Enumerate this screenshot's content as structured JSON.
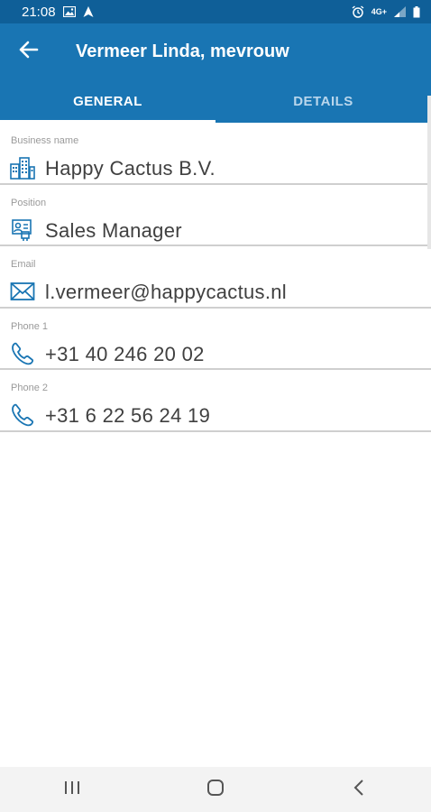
{
  "status_bar": {
    "time": "21:08",
    "network_label": "4G+"
  },
  "header": {
    "title": "Vermeer Linda, mevrouw",
    "back_icon": "arrow-left-icon"
  },
  "tabs": [
    {
      "label": "GENERAL",
      "active": true
    },
    {
      "label": "DETAILS",
      "active": false
    }
  ],
  "fields": [
    {
      "label": "Business name",
      "value": "Happy Cactus B.V.",
      "icon": "buildings-icon"
    },
    {
      "label": "Position",
      "value": "Sales Manager",
      "icon": "id-badge-icon"
    },
    {
      "label": "Email",
      "value": "l.vermeer@happycactus.nl",
      "icon": "envelope-icon"
    },
    {
      "label": "Phone 1",
      "value": "+31 40 246 20 02",
      "icon": "phone-icon"
    },
    {
      "label": "Phone 2",
      "value": "+31 6 22 56 24 19",
      "icon": "phone-icon"
    }
  ],
  "colors": {
    "app_bar": "#1975b3",
    "status_bar": "#0f5f98",
    "icon": "#1975b3"
  },
  "nav_bar": {
    "buttons": [
      "recent-apps-icon",
      "home-icon",
      "back-chevron-icon"
    ]
  }
}
